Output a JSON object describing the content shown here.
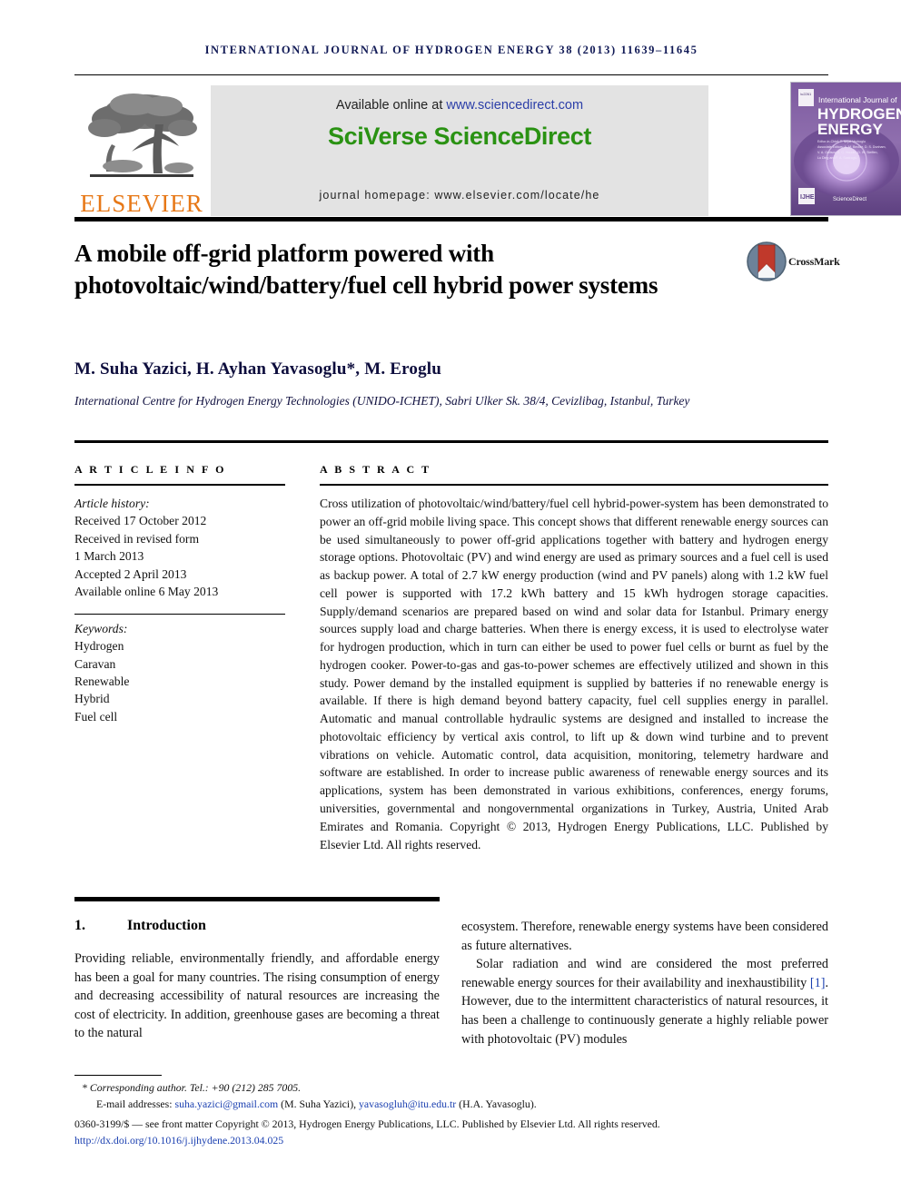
{
  "running_head": "INTERNATIONAL JOURNAL OF HYDROGEN ENERGY 38 (2013) 11639–11645",
  "masthead": {
    "publisher_name": "ELSEVIER",
    "available_prefix": "Available online at ",
    "available_url": "www.sciencedirect.com",
    "sciencedirect_logo": "SciVerse ScienceDirect",
    "journal_homepage": "journal homepage: www.elsevier.com/locate/he",
    "cover": {
      "line_small": "International Journal of",
      "line_big_1": "HYDROGEN",
      "line_big_2": "ENERGY",
      "editor_block": "Editor-in-Chief: T. Nejat Veziroglu  Associate Editors: A. M. Becker, D. S. Dunham, V. A. Goltsov, A. C. Houdin, D. W. Steffen, Lu Ding and F. A. Sastroglu",
      "footer_brand": "ScienceDirect",
      "corner_mark": "IJHE"
    }
  },
  "article": {
    "title": "A mobile off-grid platform powered with photovoltaic/wind/battery/fuel cell hybrid power systems",
    "crossmark_label": "CrossMark",
    "authors": "M. Suha Yazici, H. Ayhan Yavasoglu*, M. Eroglu",
    "affiliation": "International Centre for Hydrogen Energy Technologies (UNIDO-ICHET), Sabri Ulker Sk. 38/4, Cevizlibag, Istanbul, Turkey"
  },
  "article_info": {
    "heading": "A R T I C L E   I N F O",
    "history_label": "Article history:",
    "history": [
      "Received 17 October 2012",
      "Received in revised form",
      "1 March 2013",
      "Accepted 2 April 2013",
      "Available online 6 May 2013"
    ],
    "keywords_label": "Keywords:",
    "keywords": [
      "Hydrogen",
      "Caravan",
      "Renewable",
      "Hybrid",
      "Fuel cell"
    ]
  },
  "abstract": {
    "heading": "A B S T R A C T",
    "text": "Cross utilization of photovoltaic/wind/battery/fuel cell hybrid-power-system has been demonstrated to power an off-grid mobile living space. This concept shows that different renewable energy sources can be used simultaneously to power off-grid applications together with battery and hydrogen energy storage options. Photovoltaic (PV) and wind energy are used as primary sources and a fuel cell is used as backup power. A total of 2.7 kW energy production (wind and PV panels) along with 1.2 kW fuel cell power is supported with 17.2 kWh battery and 15 kWh hydrogen storage capacities. Supply/demand scenarios are prepared based on wind and solar data for Istanbul. Primary energy sources supply load and charge batteries. When there is energy excess, it is used to electrolyse water for hydrogen production, which in turn can either be used to power fuel cells or burnt as fuel by the hydrogen cooker. Power-to-gas and gas-to-power schemes are effectively utilized and shown in this study. Power demand by the installed equipment is supplied by batteries if no renewable energy is available. If there is high demand beyond battery capacity, fuel cell supplies energy in parallel. Automatic and manual controllable hydraulic systems are designed and installed to increase the photovoltaic efficiency by vertical axis control, to lift up & down wind turbine and to prevent vibrations on vehicle. Automatic control, data acquisition, monitoring, telemetry hardware and software are established. In order to increase public awareness of renewable energy sources and its applications, system has been demonstrated in various exhibitions, conferences, energy forums, universities, governmental and nongovernmental organizations in Turkey, Austria, United Arab Emirates and Romania.",
    "copyright": "Copyright © 2013, Hydrogen Energy Publications, LLC. Published by Elsevier Ltd. All rights reserved."
  },
  "body": {
    "section_number": "1.",
    "section_title": "Introduction",
    "left_paragraph": "Providing reliable, environmentally friendly, and affordable energy has been a goal for many countries. The rising consumption of energy and decreasing accessibility of natural resources are increasing the cost of electricity. In addition, greenhouse gases are becoming a threat to the natural",
    "right_paragraph_1": "ecosystem. Therefore, renewable energy systems have been considered as future alternatives.",
    "right_paragraph_2a": "Solar radiation and wind are considered the most preferred renewable energy sources for their availability and inexhaustibility ",
    "right_reference": "[1]",
    "right_paragraph_2b": ". However, due to the intermittent characteristics of natural resources, it has been a challenge to continuously generate a highly reliable power with photovoltaic (PV) modules"
  },
  "footnote": {
    "corresponding": "* Corresponding author. Tel.: +90 (212) 285 7005.",
    "email_label": "E-mail addresses: ",
    "email_1": "suha.yazici@gmail.com",
    "email_1_owner": " (M. Suha Yazici), ",
    "email_2": "yavasogluh@itu.edu.tr",
    "email_2_owner": " (H.A. Yavasoglu).",
    "issn_line": "0360-3199/$ — see front matter Copyright © 2013, Hydrogen Energy Publications, LLC. Published by Elsevier Ltd. All rights reserved.",
    "doi": "http://dx.doi.org/10.1016/j.ijhydene.2013.04.025"
  },
  "colors": {
    "journal_navy": "#111a56",
    "elsevier_orange": "#e77817",
    "sciencedirect_green": "#2a9213",
    "link_blue": "#1a3fb0",
    "banner_gray": "#e3e3e3"
  }
}
